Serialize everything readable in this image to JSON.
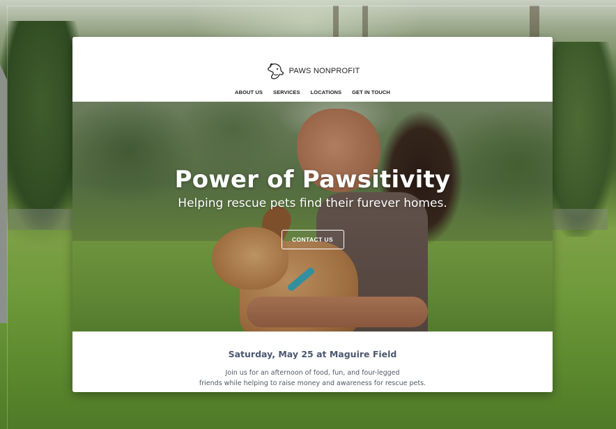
{
  "site": {
    "brand": "PAWS NONPROFIT",
    "logo_icon": "dog-head-outline-icon"
  },
  "nav": {
    "items": [
      {
        "label": "ABOUT US"
      },
      {
        "label": "SERVICES"
      },
      {
        "label": "LOCATIONS"
      },
      {
        "label": "GET IN TOUCH"
      }
    ]
  },
  "hero": {
    "title": "Power of Pawsitivity",
    "subtitle": "Helping rescue pets find their furever homes.",
    "cta_label": "CONTACT US"
  },
  "event": {
    "title": "Saturday, May 25 at Maguire Field",
    "line1": "Join us for an afternoon of food, fun, and four-legged",
    "line2": "friends while helping to raise money and awareness for rescue pets."
  },
  "colors": {
    "event_title": "#4a5870",
    "body_text": "#505866",
    "window_bg": "#ffffff",
    "window_dots": "#6b6f6d"
  }
}
